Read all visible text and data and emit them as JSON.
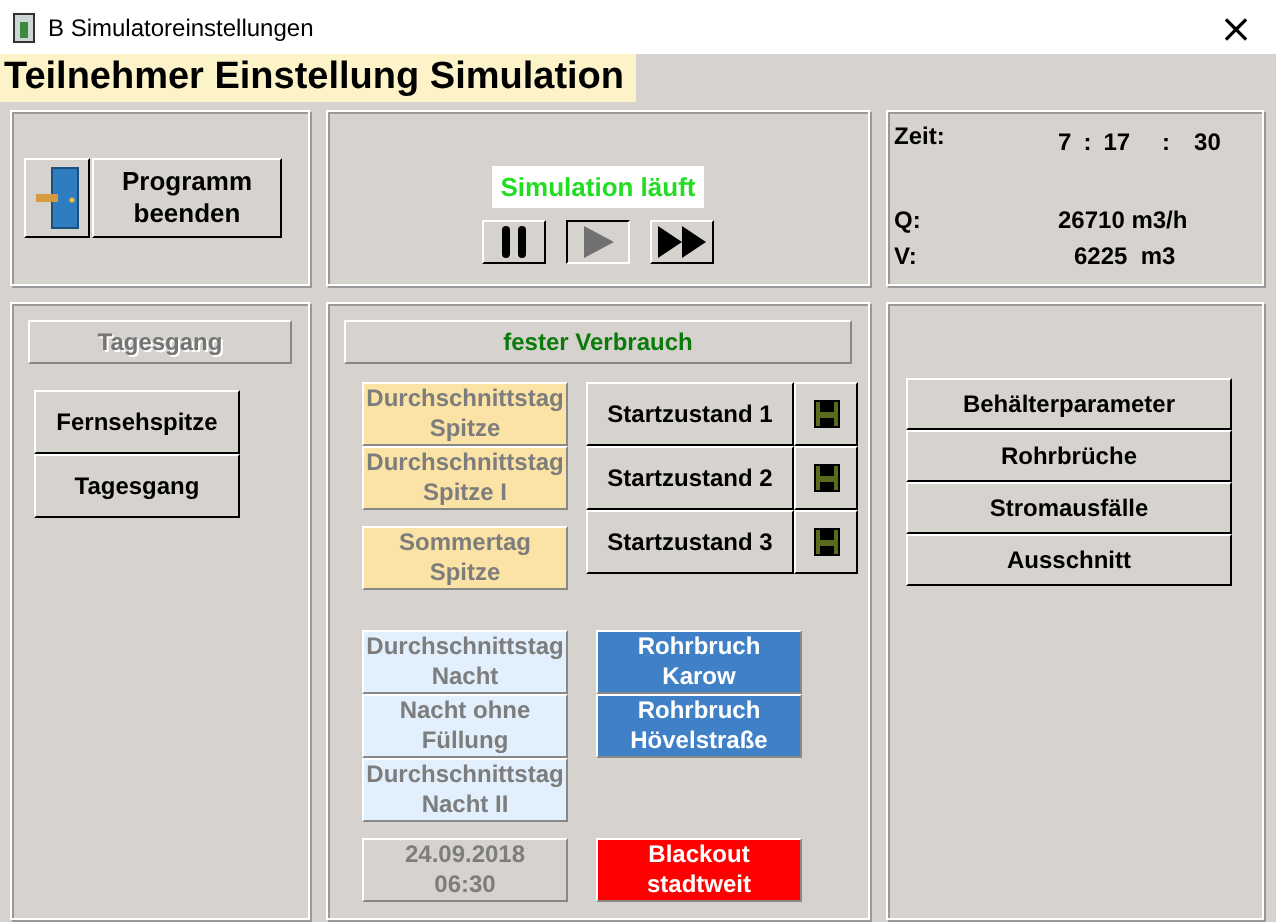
{
  "window": {
    "title": "B Simulatoreinstellungen",
    "close": "×"
  },
  "header": "Teilnehmer Einstellung Simulation",
  "exit_button": {
    "label": "Programm beenden"
  },
  "simulation": {
    "status": "Simulation läuft",
    "controls": [
      {
        "kind": "pause",
        "disabled": false
      },
      {
        "kind": "play",
        "disabled": true
      },
      {
        "kind": "fast_forward",
        "disabled": false
      }
    ]
  },
  "readout": {
    "time_label": "Zeit:",
    "hours": "7",
    "sep1": ":",
    "minutes": "17",
    "sep2": ":",
    "seconds": "30",
    "q_label": "Q:",
    "q_value": "26710 m3/h",
    "v_label": "V:",
    "v_value": "6225  m3"
  },
  "daily_profile": {
    "title": "Tagesgang",
    "title_disabled": true,
    "buttons": [
      "Fernsehspitze",
      "Tagesgang"
    ]
  },
  "fixed_consumption": {
    "title": "fester Verbrauch",
    "profiles_day": [
      {
        "label": "Durchschnittstag Spitze",
        "color": "#fbe3a6",
        "disabled": true
      },
      {
        "label": "Durchschnittstag Spitze I",
        "color": "#fbe3a6",
        "disabled": true
      },
      {
        "label": "Sommertag Spitze",
        "color": "#fbe3a6",
        "disabled": true
      }
    ],
    "start_states": [
      "Startzustand 1",
      "Startzustand 2",
      "Startzustand 3"
    ],
    "profiles_night": [
      {
        "label": "Durchschnittstag Nacht",
        "color": "#e1f0fc",
        "disabled": true
      },
      {
        "label": "Nacht ohne Füllung",
        "color": "#e1f0fc",
        "disabled": true
      },
      {
        "label": "Durchschnittstag Nacht II",
        "color": "#e1f0fc",
        "disabled": true
      }
    ],
    "pipe_breaks": [
      {
        "label": "Rohrbruch Karow",
        "color": "#3f80c6",
        "disabled": false
      },
      {
        "label": "Rohrbruch Hövelstraße",
        "color": "#3f80c6",
        "disabled": false
      }
    ],
    "date": {
      "label": "24.09.2018 06:30",
      "color": "#d6d3ce",
      "disabled": true
    },
    "blackout": {
      "label": "Blackout stadtweit",
      "color": "#ff0000",
      "disabled": false
    }
  },
  "settings_buttons": [
    "Behälterparameter",
    "Rohrbrüche",
    "Stromausfälle",
    "Ausschnitt"
  ]
}
